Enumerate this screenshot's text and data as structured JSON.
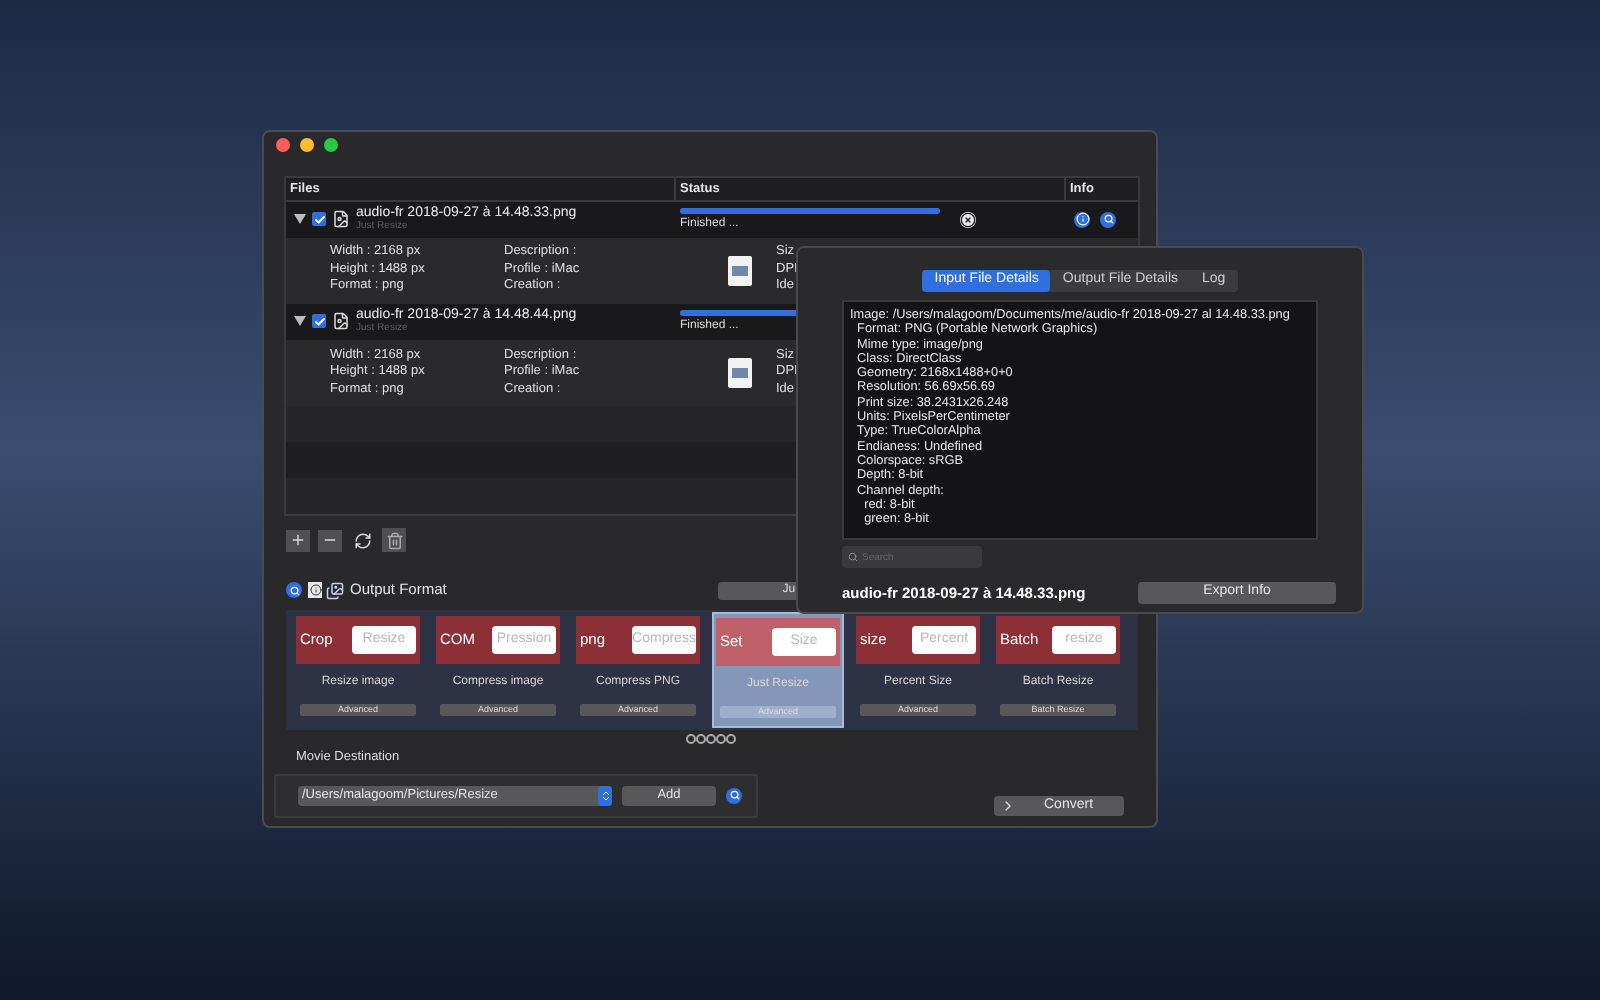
{
  "table": {
    "columns": [
      "Files",
      "Status",
      "Info"
    ],
    "files": [
      {
        "name": "audio-fr 2018-09-27 à 14.48.33.png",
        "subtitle": "Just Resize",
        "checked": true,
        "expanded": true,
        "level": 1,
        "status": "Finished ...",
        "details_left": [
          "Width : 2168 px",
          "Height : 1488 px",
          "Format : png"
        ],
        "details_mid": [
          "Description :",
          "Profile : iMac",
          "Creation :"
        ],
        "details_right": [
          "Siz",
          "DPI",
          "Ide"
        ]
      },
      {
        "name": "audio-fr 2018-09-27 à 14.48.44.png",
        "subtitle": "Just Resize",
        "checked": true,
        "expanded": true,
        "level": 1,
        "status": "Finished ...",
        "details_left": [
          "Width : 2168 px",
          "Height : 1488 px",
          "Format : png"
        ],
        "details_mid": [
          "Description :",
          "Profile : iMac",
          "Creation :"
        ],
        "details_right": [
          "Siz",
          "DPI",
          "Ide"
        ]
      }
    ]
  },
  "output_format": {
    "title": "Output Format",
    "button": "Ju"
  },
  "presets": [
    {
      "tag": "Crop",
      "field": "Resize",
      "label": "Resize image",
      "button": "Advanced",
      "selected": false
    },
    {
      "tag": "COM",
      "field": "Pression",
      "label": "Compress image",
      "button": "Advanced",
      "selected": false
    },
    {
      "tag": "png",
      "field": "Compress",
      "label": "Compress PNG",
      "button": "Advanced",
      "selected": false
    },
    {
      "tag": "Set",
      "field": "Size",
      "label": "Just Resize",
      "button": "Advanced",
      "selected": true
    },
    {
      "tag": "size",
      "field": "Percent",
      "label": "Percent Size",
      "button": "Advanced",
      "selected": false
    },
    {
      "tag": "Batch",
      "field": "resize",
      "label": "Batch Resize",
      "button": "Batch Resize",
      "selected": false
    }
  ],
  "destination": {
    "title": "Movie Destination",
    "path": "/Users/malagoom/Pictures/Resize",
    "add": "Add"
  },
  "convert": "Convert",
  "popover": {
    "tabs": [
      {
        "label": "Input File Details",
        "selected": true
      },
      {
        "label": "Output File Details",
        "selected": false
      },
      {
        "label": "Log",
        "selected": false
      }
    ],
    "lines": [
      "Image: /Users/malagoom/Documents/me/audio-fr 2018-09-27 al 14.48.33.png",
      "  Format: PNG (Portable Network Graphics)",
      "  Mime type: image/png",
      "  Class: DirectClass",
      "  Geometry: 2168x1488+0+0",
      "  Resolution: 56.69x56.69",
      "  Print size: 38.2431x26.248",
      "  Units: PixelsPerCentimeter",
      "  Type: TrueColorAlpha",
      "  Endianess: Undefined",
      "  Colorspace: sRGB",
      "  Depth: 8-bit",
      "  Channel depth:",
      "    red: 8-bit",
      "    green: 8-bit"
    ],
    "search_placeholder": "Search",
    "filename": "audio-fr 2018-09-27 à 14.48.33.png",
    "export": "Export Info"
  }
}
